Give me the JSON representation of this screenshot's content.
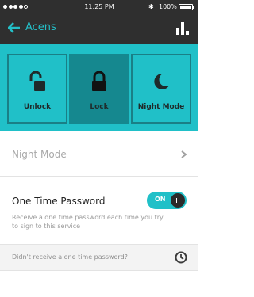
{
  "status_bar": {
    "time": "11:25 PM",
    "battery_percent": "100%",
    "signal_bars_filled": 4,
    "signal_bars_total": 5
  },
  "nav": {
    "title": "Acens",
    "back_icon": "back-arrow-icon",
    "stats_icon": "bar-chart-icon"
  },
  "modes": [
    {
      "label": "Unlock",
      "icon": "unlock-icon",
      "active": false
    },
    {
      "label": "Lock",
      "icon": "lock-icon",
      "active": true
    },
    {
      "label": "Night Mode",
      "icon": "moon-icon",
      "active": false
    }
  ],
  "night_mode_row": {
    "label": "Night Mode"
  },
  "otp": {
    "label": "One Time Password",
    "description": "Receive a one time password each time you try to sign to this service",
    "toggle_label": "ON",
    "enabled": true
  },
  "help_row": {
    "label": "Didn't receive a one time password?"
  },
  "colors": {
    "accent": "#20c0c8",
    "active_tile": "#15888f",
    "dark_bar": "#2f2f2f"
  }
}
